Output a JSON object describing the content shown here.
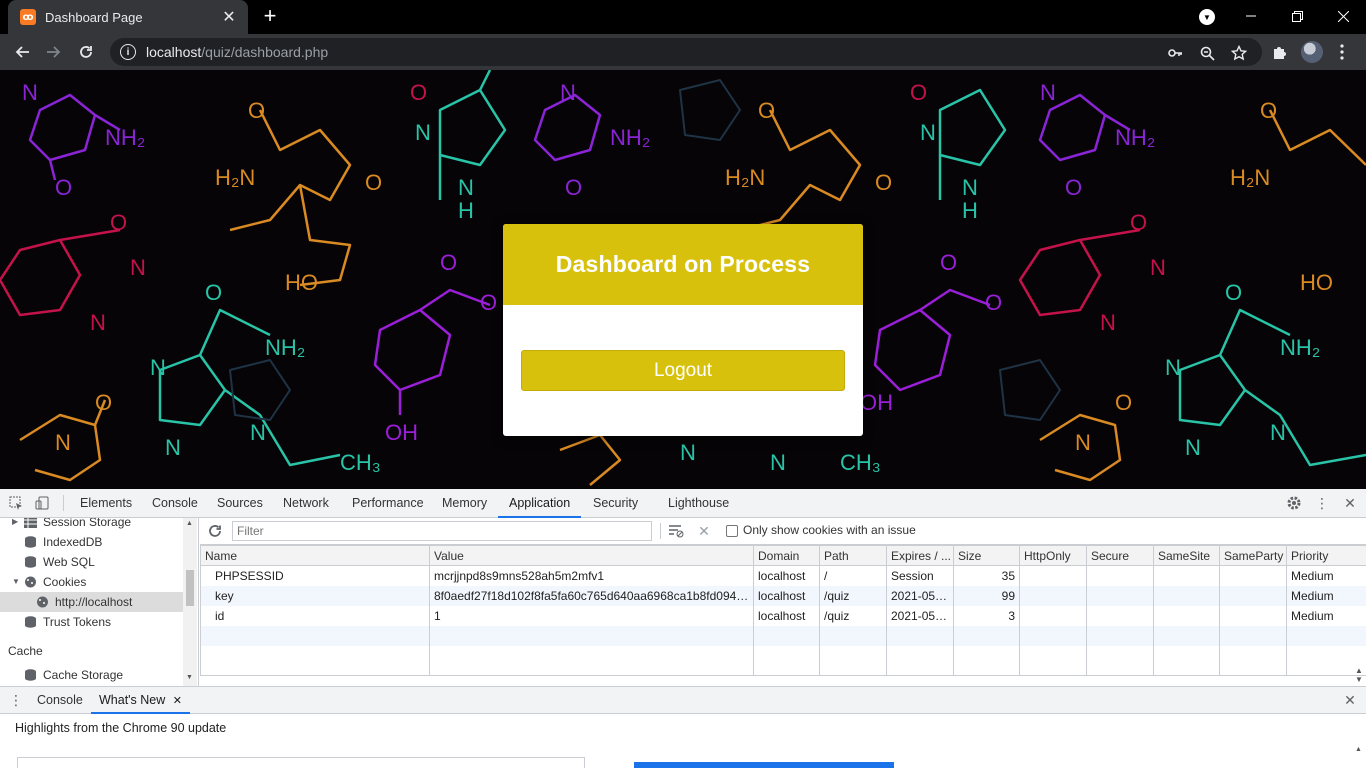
{
  "browser": {
    "tab_title": "Dashboard Page",
    "tab_favicon": "xampp-icon",
    "url_host": "localhost",
    "url_path": "/quiz/dashboard.php"
  },
  "page": {
    "card_title": "Dashboard on Process",
    "logout_label": "Logout",
    "colors": {
      "accent": "#d8c10d",
      "background": "#060406"
    }
  },
  "devtools": {
    "tabs": [
      "Elements",
      "Console",
      "Sources",
      "Network",
      "Performance",
      "Memory",
      "Application",
      "Security",
      "Lighthouse"
    ],
    "active_tab": "Application",
    "sidebar": {
      "items": [
        "Session Storage",
        "IndexedDB",
        "Web SQL",
        "Cookies",
        "http://localhost",
        "Trust Tokens"
      ],
      "section_cache": "Cache",
      "cache_item": "Cache Storage"
    },
    "filter_placeholder": "Filter",
    "only_issues_label": "Only show cookies with an issue",
    "columns": [
      "Name",
      "Value",
      "Domain",
      "Path",
      "Expires / ...",
      "Size",
      "HttpOnly",
      "Secure",
      "SameSite",
      "SameParty",
      "Priority"
    ],
    "cookies": [
      {
        "name": "PHPSESSID",
        "value": "mcrjjnpd8s9mns528ah5m2mfv1",
        "domain": "localhost",
        "path": "/",
        "expires": "Session",
        "size": "35",
        "httponly": "",
        "secure": "",
        "samesite": "",
        "sameparty": "",
        "priority": "Medium"
      },
      {
        "name": "key",
        "value": "8f0aedf27f18d102f8fa5fa60c765d640aa6968ca1b8fd094e...",
        "domain": "localhost",
        "path": "/quiz",
        "expires": "2021-05-...",
        "size": "99",
        "httponly": "",
        "secure": "",
        "samesite": "",
        "sameparty": "",
        "priority": "Medium"
      },
      {
        "name": "id",
        "value": "1",
        "domain": "localhost",
        "path": "/quiz",
        "expires": "2021-05-...",
        "size": "3",
        "httponly": "",
        "secure": "",
        "samesite": "",
        "sameparty": "",
        "priority": "Medium"
      }
    ],
    "drawer": {
      "tabs": [
        "Console",
        "What's New"
      ],
      "active": "What's New",
      "highlights": "Highlights from the Chrome 90 update"
    }
  }
}
